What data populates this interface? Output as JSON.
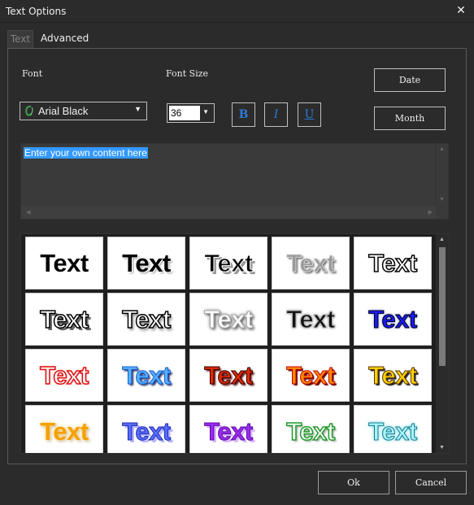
{
  "window": {
    "title": "Text Options",
    "close_glyph": "✕"
  },
  "tabs": [
    {
      "label": "Text"
    },
    {
      "label": "Advanced"
    }
  ],
  "font": {
    "label": "Font",
    "selected": "Arial Black"
  },
  "font_size": {
    "label": "Font Size",
    "value": "36"
  },
  "format_buttons": {
    "bold": "B",
    "italic": "I",
    "underline": "U"
  },
  "side_buttons": {
    "date": "Date",
    "month": "Month"
  },
  "content": {
    "text": "Enter your own content here"
  },
  "styles": {
    "sample_text": "Text",
    "rows": [
      [
        "plain-black",
        "black-outline-white",
        "black-gray-shadow",
        "gray-faded",
        "white-black-outline"
      ],
      [
        "white-black-outline-shadow",
        "white-black-outline-drop",
        "white-gray-glow",
        "black-gray-outline",
        "blue-outline"
      ],
      [
        "red-outline-white",
        "blue-light",
        "red-black-outline",
        "orange-red-outline",
        "yellow-black-outline"
      ],
      [
        "orange-glow",
        "blue-purple-shadow",
        "purple-shadow",
        "green-outline",
        "cyan-glow"
      ]
    ]
  },
  "footer": {
    "ok": "Ok",
    "cancel": "Cancel"
  },
  "colors": {
    "background": "#2b2b2b",
    "selection": "#3399ff",
    "format_icon": "#2f7bd6"
  },
  "icons": {
    "close": "close-icon",
    "font_type": "font-type-icon",
    "dropdown": "chevron-down-icon"
  }
}
